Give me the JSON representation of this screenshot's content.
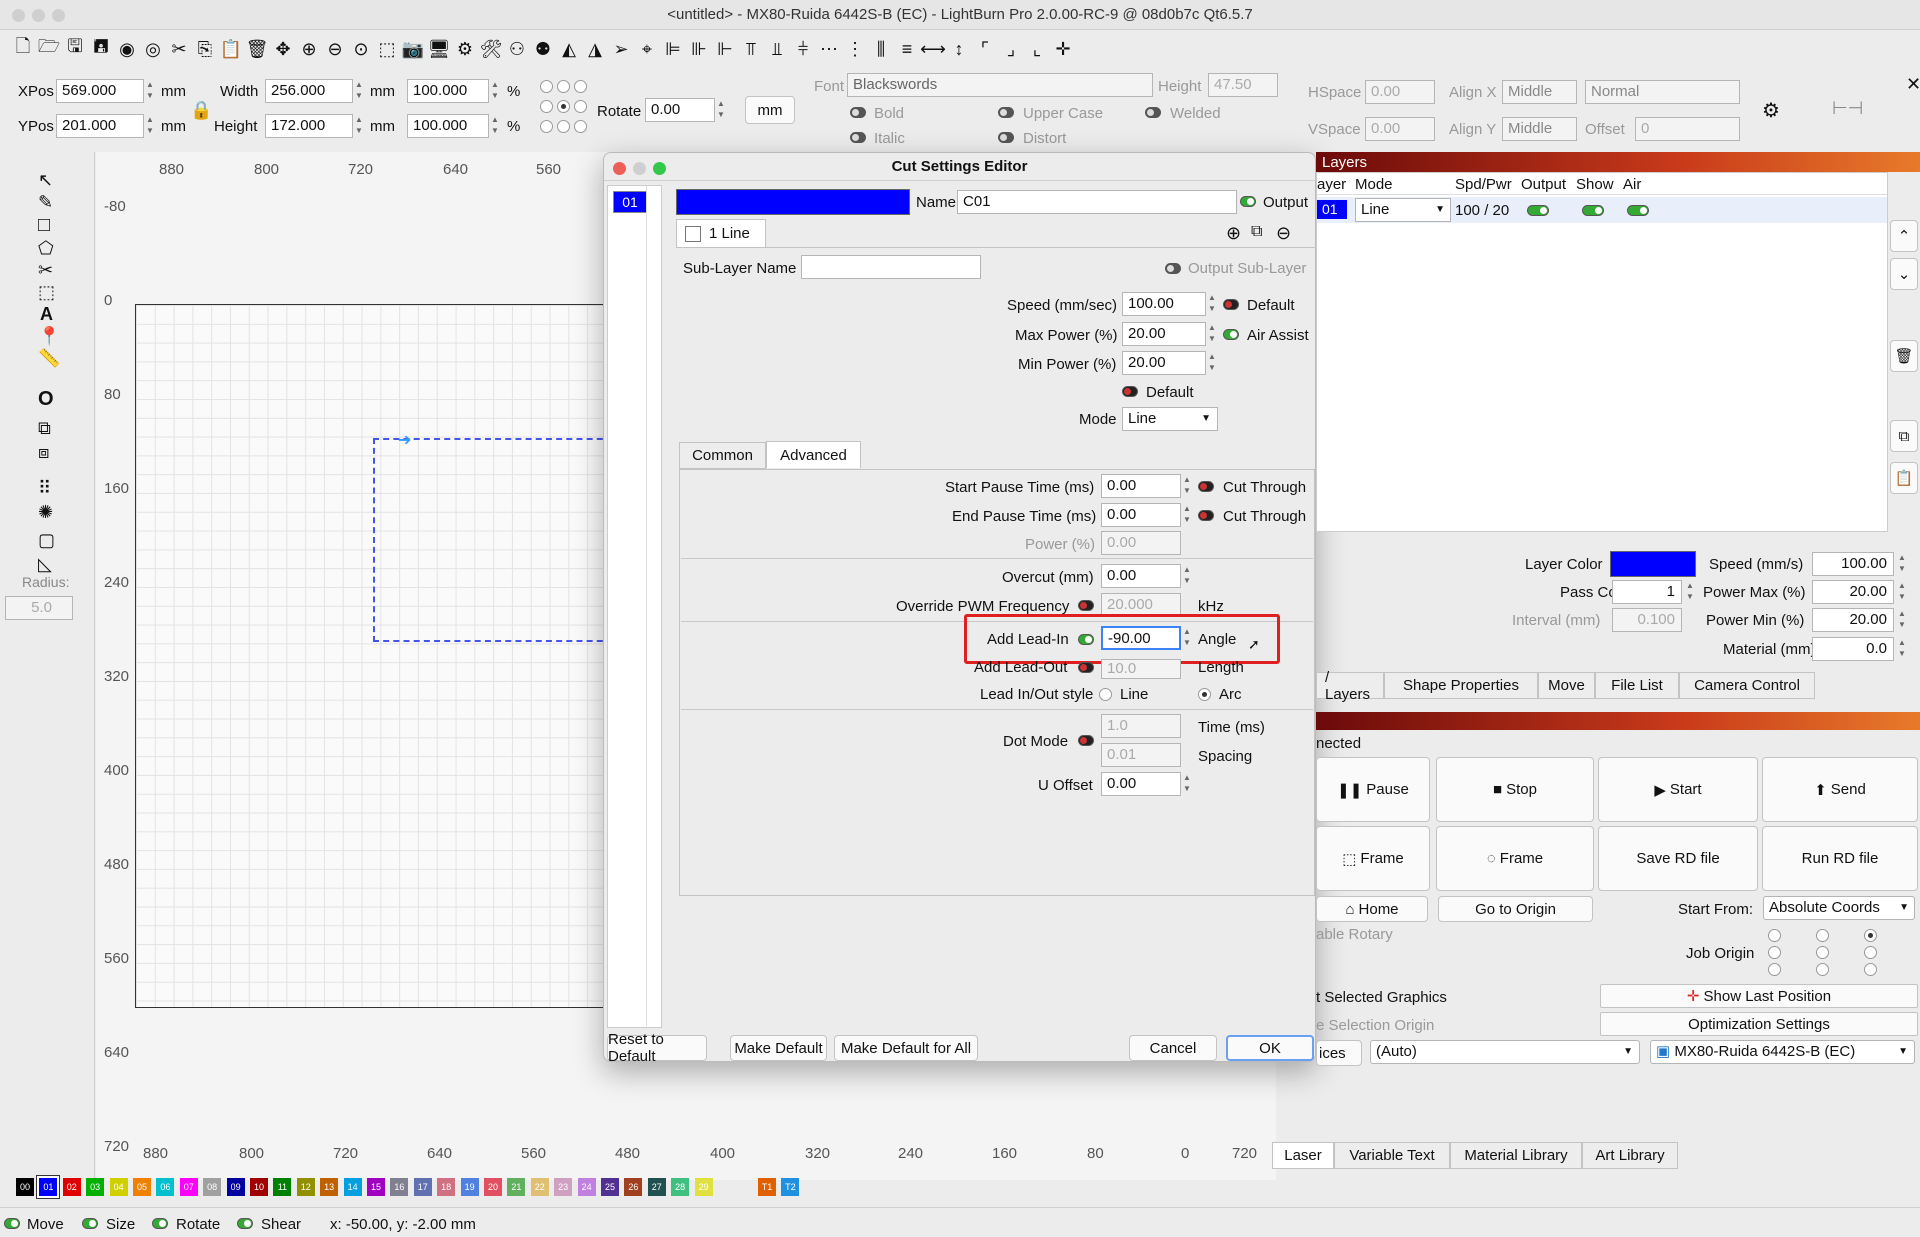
{
  "window": {
    "title": "<untitled> - MX80-Ruida 6442S-B (EC) - LightBurn Pro 2.0.00-RC-9 @ 08d0b7c Qt6.5.7"
  },
  "props": {
    "xpos_label": "XPos",
    "xpos": "569.000",
    "ypos_label": "YPos",
    "ypos": "201.000",
    "unit": "mm",
    "width_label": "Width",
    "width": "256.000",
    "height_label": "Height",
    "height": "172.000",
    "scale_w": "100.000",
    "scale_h": "100.000",
    "pct": "%",
    "rotate_label": "Rotate",
    "rotate": "0.00",
    "mm_button": "mm"
  },
  "font": {
    "font_label": "Font",
    "font": "Blackswords",
    "height_label": "Height",
    "height": "47.50",
    "bold": "Bold",
    "italic": "Italic",
    "upper": "Upper Case",
    "distort": "Distort",
    "welded": "Welded",
    "hspace_label": "HSpace",
    "hspace": "0.00",
    "vspace_label": "VSpace",
    "vspace": "0.00",
    "alignx_label": "Align X",
    "alignx": "Middle",
    "aligny_label": "Align Y",
    "aligny": "Middle",
    "normal": "Normal",
    "offset_label": "Offset",
    "offset": "0"
  },
  "ruler": {
    "top": [
      "880",
      "800",
      "720",
      "640",
      "560"
    ],
    "left": [
      "-80",
      "0",
      "80",
      "160",
      "240",
      "320",
      "400",
      "480",
      "560",
      "640",
      "720"
    ],
    "bottom": [
      "880",
      "800",
      "720",
      "640",
      "560",
      "480",
      "400",
      "320",
      "240",
      "160",
      "80",
      "0",
      "720"
    ]
  },
  "tools": {
    "radius_label": "Radius:",
    "radius": "5.0"
  },
  "dialog": {
    "title": "Cut Settings Editor",
    "layer_item": "01",
    "name_label": "Name",
    "name": "C01",
    "output": "Output",
    "sublayer_tab": "1 Line",
    "sublayer_name_label": "Sub-Layer Name",
    "output_sublayer": "Output Sub-Layer",
    "speed_label": "Speed (mm/sec)",
    "speed": "100.00",
    "default1": "Default",
    "max_power_label": "Max Power (%)",
    "max_power": "20.00",
    "air_assist": "Air Assist",
    "min_power_label": "Min Power (%)",
    "min_power": "20.00",
    "default2": "Default",
    "mode_label": "Mode",
    "mode": "Line",
    "tab_common": "Common",
    "tab_advanced": "Advanced",
    "start_pause_label": "Start Pause Time (ms)",
    "start_pause": "0.00",
    "cut_through1": "Cut Through",
    "end_pause_label": "End Pause Time (ms)",
    "end_pause": "0.00",
    "cut_through2": "Cut Through",
    "power_label": "Power (%)",
    "power": "0.00",
    "overcut_label": "Overcut (mm)",
    "overcut": "0.00",
    "pwm_label": "Override PWM Frequency",
    "pwm": "20.000",
    "khz": "kHz",
    "leadin_label": "Add Lead-In",
    "leadin": "-90.00",
    "angle": "Angle",
    "leadout_label": "Add Lead-Out",
    "leadout": "10.0",
    "length": "Length",
    "style_label": "Lead In/Out style",
    "style_line": "Line",
    "style_arc": "Arc",
    "dot_label": "Dot Mode",
    "dot_time": "1.0",
    "time_ms": "Time (ms)",
    "dot_spacing": "0.01",
    "spacing": "Spacing",
    "uoffset_label": "U Offset",
    "uoffset": "0.00",
    "reset": "Reset to Default",
    "make_default": "Make Default",
    "make_default_all": "Make Default for All",
    "cancel": "Cancel",
    "ok": "OK"
  },
  "layers": {
    "header": "Layers",
    "cols": [
      "ayer",
      "Mode",
      "Spd/Pwr",
      "Output",
      "Show",
      "Air"
    ],
    "row": {
      "num": "01",
      "mode": "Line",
      "spdpwr": "100 / 20"
    },
    "layer_color_label": "Layer Color",
    "speed_label": "Speed (mm/s)",
    "speed": "100.00",
    "pass_label": "Pass Count",
    "pass": "1",
    "pmax_label": "Power Max (%)",
    "pmax": "20.00",
    "interval_label": "Interval (mm)",
    "interval": "0.100",
    "pmin_label": "Power Min (%)",
    "pmin": "20.00",
    "material_label": "Material (mm)",
    "material": "0.0"
  },
  "right_tabs": [
    "/ Layers",
    "Shape Properties",
    "Move",
    "File List",
    "Camera Control"
  ],
  "laser": {
    "status": "nected",
    "pause": "Pause",
    "stop": "Stop",
    "start": "Start",
    "send": "Send",
    "frame1": "Frame",
    "frame2": "Frame",
    "save_rd": "Save RD file",
    "run_rd": "Run RD file",
    "home": "Home",
    "go_origin": "Go to Origin",
    "start_from_label": "Start From:",
    "start_from": "Absolute Coords",
    "rotary": "able Rotary",
    "job_origin": "Job Origin",
    "selected": "t Selected Graphics",
    "show_last": "Show Last Position",
    "sel_origin": "e Selection Origin",
    "opt": "Optimization Settings",
    "devices": "ices",
    "auto": "(Auto)",
    "device": "MX80-Ruida 6442S-B (EC)"
  },
  "bottom_tabs": [
    "Laser",
    "Variable Text",
    "Material Library",
    "Art Library"
  ],
  "palette": [
    {
      "l": "00",
      "c": "#000000"
    },
    {
      "l": "01",
      "c": "#0000ff"
    },
    {
      "l": "02",
      "c": "#e00000"
    },
    {
      "l": "03",
      "c": "#00b000"
    },
    {
      "l": "04",
      "c": "#d0d000"
    },
    {
      "l": "05",
      "c": "#f08000"
    },
    {
      "l": "06",
      "c": "#00c0d0"
    },
    {
      "l": "07",
      "c": "#ff00ff"
    },
    {
      "l": "08",
      "c": "#a0a0a0"
    },
    {
      "l": "09",
      "c": "#0000a0"
    },
    {
      "l": "10",
      "c": "#a00000"
    },
    {
      "l": "11",
      "c": "#008000"
    },
    {
      "l": "12",
      "c": "#909000"
    },
    {
      "l": "13",
      "c": "#c06000"
    },
    {
      "l": "14",
      "c": "#00a0e0"
    },
    {
      "l": "15",
      "c": "#a000c0"
    },
    {
      "l": "16",
      "c": "#808090"
    },
    {
      "l": "17",
      "c": "#6070b0"
    },
    {
      "l": "18",
      "c": "#d07080"
    },
    {
      "l": "19",
      "c": "#5080e0"
    },
    {
      "l": "20",
      "c": "#e05060"
    },
    {
      "l": "21",
      "c": "#60b060"
    },
    {
      "l": "22",
      "c": "#e0c070"
    },
    {
      "l": "23",
      "c": "#d0a0c0"
    },
    {
      "l": "24",
      "c": "#c080e0"
    },
    {
      "l": "25",
      "c": "#503090"
    },
    {
      "l": "26",
      "c": "#a04020"
    },
    {
      "l": "27",
      "c": "#205050"
    },
    {
      "l": "28",
      "c": "#40c080"
    },
    {
      "l": "29",
      "c": "#e0e040"
    },
    {
      "l": "T1",
      "c": "#e06000"
    },
    {
      "l": "T2",
      "c": "#2090e0"
    }
  ],
  "statusbar": {
    "move": "Move",
    "size": "Size",
    "rotate": "Rotate",
    "shear": "Shear",
    "coords": "x: -50.00, y: -2.00 mm"
  },
  "colors": {
    "accent": "#0000ff",
    "highlight": "#e02020"
  }
}
